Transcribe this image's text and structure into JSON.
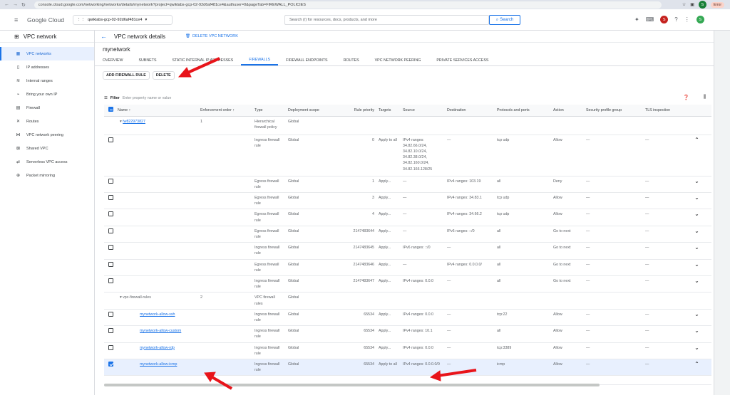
{
  "browser": {
    "url": "console.cloud.google.com/networking/networks/details/mynetwork?project=qwiklabs-gcp-02-92d6af481ce4&authuser=0&pageTab=FIREWALL_POLICIES",
    "error_label": "Error",
    "avatar": "S"
  },
  "topbar": {
    "logo": "Google Cloud",
    "project": "qwiklabs-gcp-02-92d6af481ce4",
    "search_placeholder": "Search (/) for resources, docs, products, and more",
    "search_button": "Search",
    "avatar1": "S",
    "avatar2": "S"
  },
  "sidebar": {
    "title": "VPC network",
    "items": [
      {
        "label": "VPC networks",
        "icon": "grid-icon"
      },
      {
        "label": "IP addresses",
        "icon": "ip-icon"
      },
      {
        "label": "Internal ranges",
        "icon": "range-icon"
      },
      {
        "label": "Bring your own IP",
        "icon": "byoip-icon"
      },
      {
        "label": "Firewall",
        "icon": "firewall-icon"
      },
      {
        "label": "Routes",
        "icon": "routes-icon"
      },
      {
        "label": "VPC network peering",
        "icon": "peering-icon"
      },
      {
        "label": "Shared VPC",
        "icon": "shared-icon"
      },
      {
        "label": "Serverless VPC access",
        "icon": "serverless-icon"
      },
      {
        "label": "Packet mirroring",
        "icon": "mirroring-icon"
      }
    ]
  },
  "page": {
    "title": "VPC network details",
    "delete_network": "DELETE VPC NETWORK",
    "network_name": "mynetwork"
  },
  "tabs": [
    "OVERVIEW",
    "SUBNETS",
    "STATIC INTERNAL IP ADDRESSES",
    "FIREWALLS",
    "FIREWALL ENDPOINTS",
    "ROUTES",
    "VPC NETWORK PEERING",
    "PRIVATE SERVICES ACCESS"
  ],
  "actions": {
    "add": "ADD FIREWALL RULE",
    "delete": "DELETE"
  },
  "filter": {
    "label": "Filter",
    "placeholder": "Enter property name or value"
  },
  "columns": [
    "Name",
    "Enforcement order",
    "Type",
    "Deployment scope",
    "Rule priority",
    "Targets",
    "Source",
    "Destination",
    "Protocols and ports",
    "Action",
    "Security profile group",
    "TLS inspection"
  ],
  "rows": [
    {
      "kind": "group",
      "name": "fw822973827",
      "order": "1",
      "type": "Hierarchical firewall policy",
      "scope": "Global",
      "priority": "",
      "targets": "",
      "source": "",
      "dest": "",
      "proto": "",
      "action": "",
      "spg": "",
      "tls": "",
      "chev": ""
    },
    {
      "kind": "rule",
      "checked": false,
      "name": "",
      "order": "",
      "type": "Ingress firewall rule",
      "scope": "Global",
      "priority": "0",
      "targets": "Apply to all",
      "source": "IPv4 ranges: 34.82.66.0/24, 34.82.10.0/24, 34.82.38.0/24, 34.82.160.0/24, 34.82.166.128/25",
      "dest": "—",
      "proto": "tcp udp",
      "action": "Allow",
      "spg": "—",
      "tls": "—",
      "chev": "⌃"
    },
    {
      "kind": "rule",
      "checked": false,
      "name": "",
      "order": "",
      "type": "Egress firewall rule",
      "scope": "Global",
      "priority": "1",
      "targets": "Apply...",
      "source": "—",
      "dest": "IPv4 ranges: 103.19",
      "proto": "all",
      "action": "Deny",
      "spg": "—",
      "tls": "—",
      "chev": "⌄"
    },
    {
      "kind": "rule",
      "checked": false,
      "name": "",
      "order": "",
      "type": "Egress firewall rule",
      "scope": "Global",
      "priority": "3",
      "targets": "Apply...",
      "source": "—",
      "dest": "IPv4 ranges: 34.83.1",
      "proto": "tcp udp",
      "action": "Allow",
      "spg": "—",
      "tls": "—",
      "chev": "⌄"
    },
    {
      "kind": "rule",
      "checked": false,
      "name": "",
      "order": "",
      "type": "Egress firewall rule",
      "scope": "Global",
      "priority": "4",
      "targets": "Apply...",
      "source": "—",
      "dest": "IPv4 ranges: 34.66.2",
      "proto": "tcp udp",
      "action": "Allow",
      "spg": "—",
      "tls": "—",
      "chev": "⌄"
    },
    {
      "kind": "rule",
      "checked": false,
      "name": "",
      "order": "",
      "type": "Egress firewall rule",
      "scope": "Global",
      "priority": "2147483644",
      "targets": "Apply...",
      "source": "—",
      "dest": "IPv6 ranges: ::/0",
      "proto": "all",
      "action": "Go to next",
      "spg": "—",
      "tls": "—",
      "chev": "⌄"
    },
    {
      "kind": "rule",
      "checked": false,
      "name": "",
      "order": "",
      "type": "Ingress firewall rule",
      "scope": "Global",
      "priority": "2147483645",
      "targets": "Apply...",
      "source": "IPv6 ranges: ::/0",
      "dest": "—",
      "proto": "all",
      "action": "Go to next",
      "spg": "—",
      "tls": "—",
      "chev": "⌄"
    },
    {
      "kind": "rule",
      "checked": false,
      "name": "",
      "order": "",
      "type": "Egress firewall rule",
      "scope": "Global",
      "priority": "2147483646",
      "targets": "Apply...",
      "source": "—",
      "dest": "IPv4 ranges: 0.0.0.0/",
      "proto": "all",
      "action": "Go to next",
      "spg": "—",
      "tls": "—",
      "chev": "⌄"
    },
    {
      "kind": "rule",
      "checked": false,
      "name": "",
      "order": "",
      "type": "Ingress firewall rule",
      "scope": "Global",
      "priority": "2147483647",
      "targets": "Apply...",
      "source": "IPv4 ranges: 0.0.0",
      "dest": "—",
      "proto": "all",
      "action": "Go to next",
      "spg": "—",
      "tls": "—",
      "chev": "⌄"
    },
    {
      "kind": "group",
      "name": "vpc-firewall-rules",
      "order": "2",
      "type": "VPC firewall rules",
      "scope": "Global",
      "priority": "",
      "targets": "",
      "source": "",
      "dest": "",
      "proto": "",
      "action": "",
      "spg": "",
      "tls": "",
      "chev": ""
    },
    {
      "kind": "rule",
      "checked": false,
      "name": "mynetwork-allow-ssh",
      "order": "",
      "type": "Ingress firewall rule",
      "scope": "Global",
      "priority": "65534",
      "targets": "Apply...",
      "source": "IPv4 ranges: 0.0.0",
      "dest": "—",
      "proto": "tcp:22",
      "action": "Allow",
      "spg": "—",
      "tls": "—",
      "chev": "⌄"
    },
    {
      "kind": "rule",
      "checked": false,
      "name": "mynetwork-allow-custom",
      "order": "",
      "type": "Ingress firewall rule",
      "scope": "Global",
      "priority": "65534",
      "targets": "Apply...",
      "source": "IPv4 ranges: 10.1",
      "dest": "—",
      "proto": "all",
      "action": "Allow",
      "spg": "—",
      "tls": "—",
      "chev": "⌄"
    },
    {
      "kind": "rule",
      "checked": false,
      "name": "mynetwork-allow-rdp",
      "order": "",
      "type": "Ingress firewall rule",
      "scope": "Global",
      "priority": "65534",
      "targets": "Apply...",
      "source": "IPv4 ranges: 0.0.0",
      "dest": "—",
      "proto": "tcp:3389",
      "action": "Allow",
      "spg": "—",
      "tls": "—",
      "chev": "⌄"
    },
    {
      "kind": "rule",
      "checked": true,
      "name": "mynetwork-allow-icmp",
      "order": "",
      "type": "Ingress firewall rule",
      "scope": "Global",
      "priority": "65534",
      "targets": "Apply to all",
      "source": "IPv4 ranges: 0.0.0.0/0",
      "dest": "—",
      "proto": "icmp",
      "action": "Allow",
      "spg": "—",
      "tls": "—",
      "chev": "⌃"
    }
  ],
  "colors": {
    "accent": "#1a73e8",
    "arrow": "#e8141a",
    "selected_row": "#e8f0fe"
  }
}
